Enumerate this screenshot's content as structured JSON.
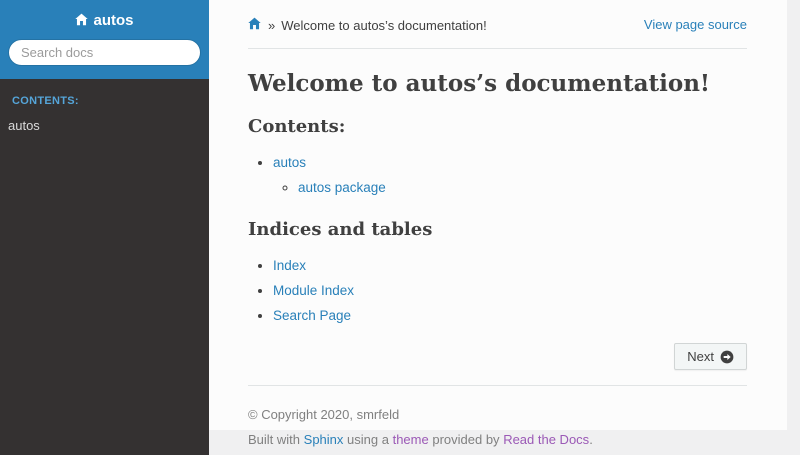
{
  "sidebar": {
    "title": "autos",
    "search_placeholder": "Search docs",
    "caption": "CONTENTS:",
    "items": [
      {
        "label": "autos"
      }
    ]
  },
  "breadcrumb": {
    "separator": "»",
    "current": "Welcome to autos’s documentation!",
    "view_source": "View page source"
  },
  "main": {
    "title": "Welcome to autos’s documentation!",
    "contents_heading": "Contents:",
    "toc": [
      {
        "label": "autos",
        "children": [
          {
            "label": "autos package"
          }
        ]
      }
    ],
    "indices_heading": "Indices and tables",
    "indices_links": [
      "Index",
      "Module Index",
      "Search Page"
    ],
    "next_label": "Next"
  },
  "footer": {
    "copyright": "© Copyright 2020, smrfeld",
    "built_prefix": "Built with",
    "sphinx_link": "Sphinx",
    "using_text": "using a",
    "theme_link": "theme",
    "provided_text": "provided by",
    "rtd_link": "Read the Docs",
    "period": "."
  },
  "colors": {
    "header_blue": "#2980b9",
    "sidebar_dark": "#343131",
    "caption_blue": "#55a5d9",
    "link_blue": "#2980b9",
    "link_visited_purple": "#9b59b6",
    "body_text": "#404040",
    "footer_gray": "#808080",
    "content_bg": "#fcfcfc",
    "page_bg": "#f0f0f1",
    "divider": "#e1e4e5"
  }
}
